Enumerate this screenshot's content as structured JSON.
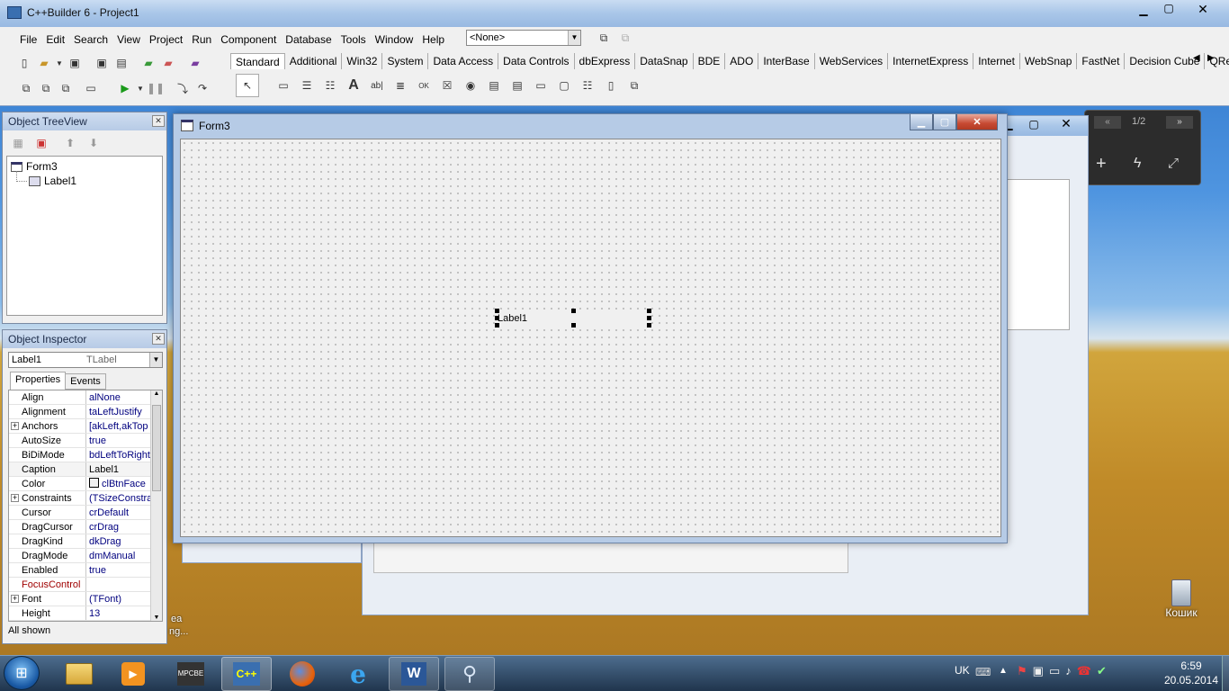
{
  "main_window": {
    "title": "C++Builder 6 - Project1",
    "menu": [
      "File",
      "Edit",
      "Search",
      "View",
      "Project",
      "Run",
      "Component",
      "Database",
      "Tools",
      "Window",
      "Help"
    ],
    "config_dropdown": "<None>",
    "palette_tabs": [
      "Standard",
      "Additional",
      "Win32",
      "System",
      "Data Access",
      "Data Controls",
      "dbExpress",
      "DataSnap",
      "BDE",
      "ADO",
      "InterBase",
      "WebServices",
      "InternetExpress",
      "Internet",
      "WebSnap",
      "FastNet",
      "Decision Cube",
      "QReport"
    ]
  },
  "tree_view": {
    "title": "Object TreeView",
    "items": [
      {
        "label": "Form3"
      },
      {
        "label": "Label1"
      }
    ]
  },
  "inspector": {
    "title": "Object Inspector",
    "selected_name": "Label1",
    "selected_type": "TLabel",
    "tabs": [
      "Properties",
      "Events"
    ],
    "rows": [
      {
        "name": "Align",
        "value": "alNone",
        "expand": ""
      },
      {
        "name": "Alignment",
        "value": "taLeftJustify",
        "expand": ""
      },
      {
        "name": "Anchors",
        "value": "[akLeft,akTop",
        "expand": "+"
      },
      {
        "name": "AutoSize",
        "value": "true",
        "expand": ""
      },
      {
        "name": "BiDiMode",
        "value": "bdLeftToRight",
        "expand": ""
      },
      {
        "name": "Caption",
        "value": "Label1",
        "expand": ""
      },
      {
        "name": "Color",
        "value": "clBtnFace",
        "expand": ""
      },
      {
        "name": "Constraints",
        "value": "(TSizeConstra",
        "expand": "+"
      },
      {
        "name": "Cursor",
        "value": "crDefault",
        "expand": ""
      },
      {
        "name": "DragCursor",
        "value": "crDrag",
        "expand": ""
      },
      {
        "name": "DragKind",
        "value": "dkDrag",
        "expand": ""
      },
      {
        "name": "DragMode",
        "value": "dmManual",
        "expand": ""
      },
      {
        "name": "Enabled",
        "value": "true",
        "expand": ""
      },
      {
        "name": "FocusControl",
        "value": "",
        "expand": ""
      },
      {
        "name": "Font",
        "value": "(TFont)",
        "expand": "+"
      },
      {
        "name": "Height",
        "value": "13",
        "expand": ""
      }
    ],
    "status": "All shown",
    "highlight_color": "#a00000"
  },
  "form": {
    "title": "Form3",
    "label_caption": "Label1"
  },
  "gadget": {
    "page": "1/2"
  },
  "desktop": {
    "recycle_bin": "Кошик",
    "partial_text_1": "ea",
    "partial_text_2": "ng..."
  },
  "taskbar": {
    "lang": "UK",
    "time": "6:59",
    "date": "20.05.2014",
    "apps": [
      "explorer-icon",
      "media-player-icon",
      "mpcbe-icon",
      "cbuilder-icon",
      "firefox-icon",
      "ie-icon",
      "word-icon",
      "search-tool-icon"
    ]
  },
  "colors": {
    "accent": "#3a6fb0",
    "property_value": "#00007f"
  }
}
